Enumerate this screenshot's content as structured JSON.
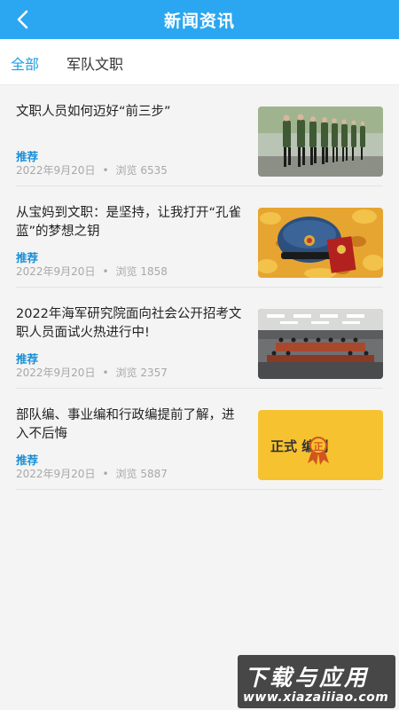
{
  "header": {
    "back_icon": "chevron-left-icon",
    "title": "新闻资讯"
  },
  "tabs": [
    {
      "label": "全部",
      "active": true
    },
    {
      "label": "军队文职",
      "active": false
    }
  ],
  "articles": [
    {
      "title": "文职人员如何迈好“前三步”",
      "tag": "推荐",
      "date": "2022年9月20日",
      "separator": "•",
      "views": "浏览 6535",
      "thumb": "marching-soldiers-image"
    },
    {
      "title": "从宝妈到文职：是坚持，让我打开“孔雀蓝”的梦想之钥",
      "tag": "推荐",
      "date": "2022年9月20日",
      "separator": "•",
      "views": "浏览 1858",
      "thumb": "military-cap-image"
    },
    {
      "title": "2022年海军研究院面向社会公开招考文职人员面试火热进行中!",
      "tag": "推荐",
      "date": "2022年9月20日",
      "separator": "•",
      "views": "浏览 2357",
      "thumb": "conference-room-image"
    },
    {
      "title": "部队编、事业编和行政编提前了解，进入不后悔",
      "tag": "推荐",
      "date": "2022年9月20日",
      "separator": "•",
      "views": "浏览 5887",
      "thumb": "formal-staffing-image",
      "thumb_text": "正式 编制",
      "thumb_badge": "正"
    }
  ],
  "watermark": {
    "text": "下载与应用",
    "url": "www.xiazaiiiao.com"
  },
  "colors": {
    "header": "#2aa7f0",
    "accent": "#1fa0e6",
    "tag": "#1a8fd6"
  }
}
